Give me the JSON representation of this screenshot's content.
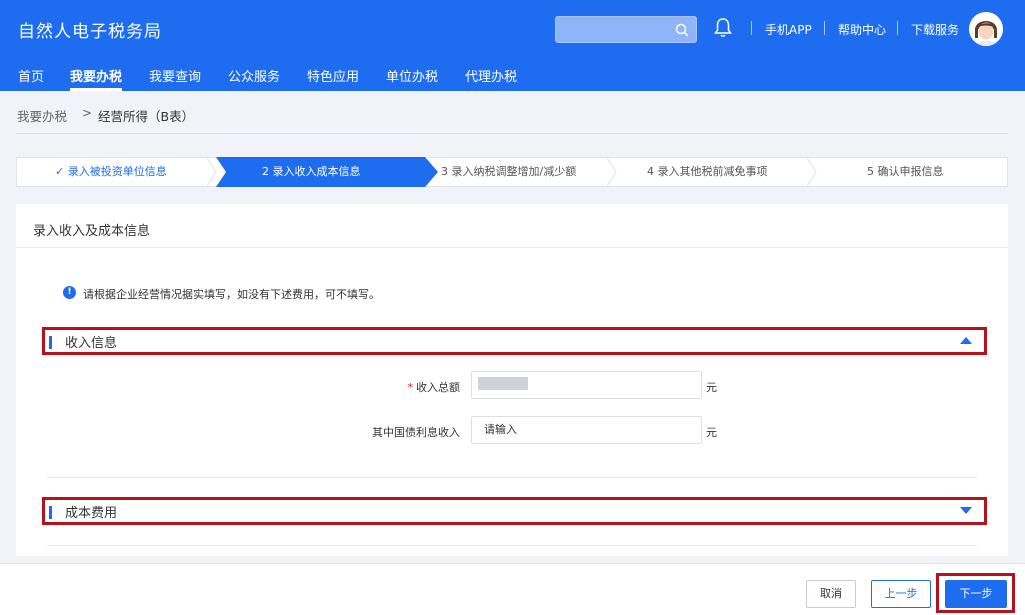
{
  "header": {
    "title": "自然人电子税务局",
    "links": [
      "手机APP",
      "帮助中心",
      "下载服务"
    ]
  },
  "nav": {
    "items": [
      "首页",
      "我要办税",
      "我要查询",
      "公众服务",
      "特色应用",
      "单位办税",
      "代理办税"
    ],
    "active": "我要办税"
  },
  "breadcrumb": {
    "parent": "我要办税",
    "separator": ">",
    "current": "经营所得（B表）"
  },
  "steps": [
    {
      "label": "✓ 录入被投资单位信息",
      "status": "done"
    },
    {
      "label": "2  录入收入成本信息",
      "status": "active"
    },
    {
      "label": "3  录入纳税调整增加/减少额",
      "status": "todo"
    },
    {
      "label": "4  录入其他税前减免事项",
      "status": "todo"
    },
    {
      "label": "5  确认申报信息",
      "status": "todo"
    }
  ],
  "card": {
    "title": "录入收入及成本信息",
    "notice": "请根据企业经营情况据实填写，如没有下述费用，可不填写。",
    "notice_icon": "!"
  },
  "income_section": {
    "label": "收入信息",
    "expanded": true,
    "fields": [
      {
        "label": "收入总额",
        "required": "*",
        "value": "",
        "placeholder": "",
        "unit": "元"
      },
      {
        "label": "其中国债利息收入",
        "required": "",
        "value": "",
        "placeholder": "请输入",
        "unit": "元"
      }
    ]
  },
  "cost_section": {
    "label": "成本费用",
    "expanded": false
  },
  "footer": {
    "cancel": "取消",
    "prev": "上一步",
    "next": "下一步"
  },
  "colors": {
    "brand_blue": "#1e6cf0",
    "highlight_red": "#b5121b"
  }
}
